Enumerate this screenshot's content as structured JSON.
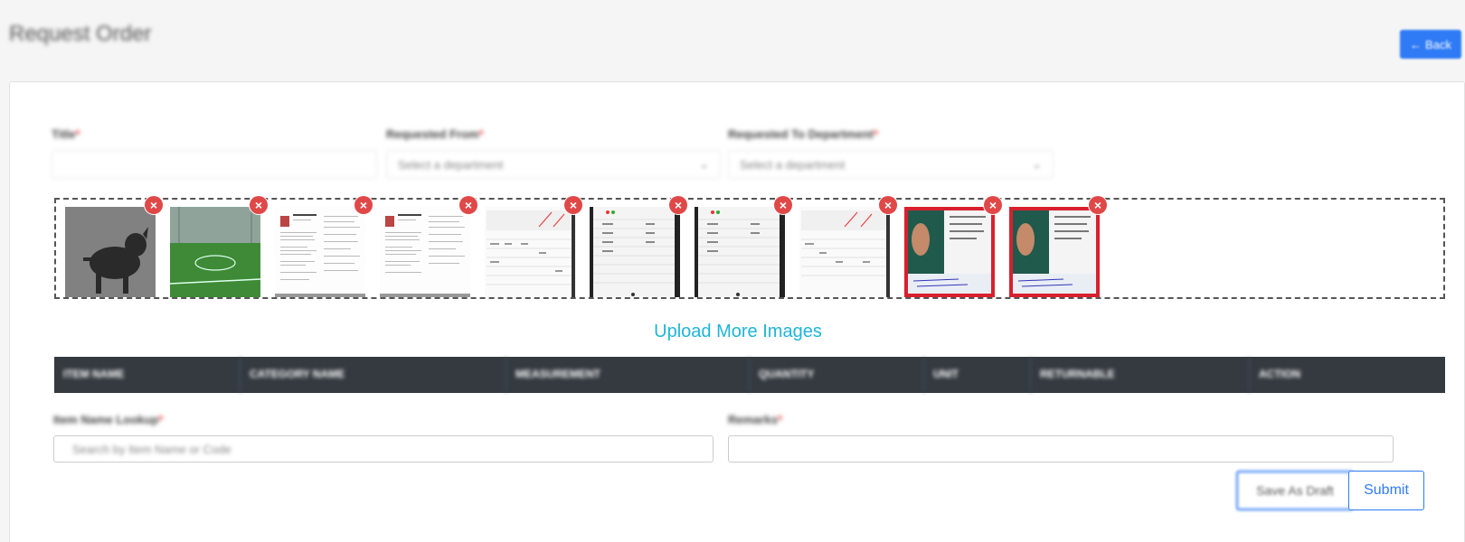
{
  "header": {
    "title": "Request Order",
    "back_label": "Back",
    "back_icon": "arrow-left-icon"
  },
  "form": {
    "title_label": "Title",
    "from_label": "Requested From",
    "from_placeholder": "Select a department",
    "to_label": "Requested To Department",
    "to_placeholder": "Select a department",
    "required_mark": "*"
  },
  "images": [
    {
      "name": "dog-photo",
      "kind": "dog"
    },
    {
      "name": "football-field-photo",
      "kind": "field"
    },
    {
      "name": "resume-document",
      "kind": "resume"
    },
    {
      "name": "resume-document-2",
      "kind": "resume"
    },
    {
      "name": "table-screenshot",
      "kind": "table-light"
    },
    {
      "name": "table-screenshot-dark",
      "kind": "table-dark"
    },
    {
      "name": "table-screenshot-dark-2",
      "kind": "table-dark"
    },
    {
      "name": "table-screenshot-2",
      "kind": "table-light"
    },
    {
      "name": "passport-photo",
      "kind": "passport"
    },
    {
      "name": "passport-photo-2",
      "kind": "passport"
    }
  ],
  "upload_more_label": "Upload More Images",
  "table": {
    "columns": [
      "ITEM NAME",
      "CATEGORY NAME",
      "MEASUREMENT",
      "QUANTITY",
      "UNIT",
      "RETURNABLE",
      "ACTION"
    ]
  },
  "lookup": {
    "label": "Item Name Lookup",
    "placeholder": "Search by Item Name or Code",
    "remarks_label": "Remarks"
  },
  "actions": {
    "draft_label": "Save As Draft",
    "submit_label": "Submit"
  },
  "colors": {
    "primary": "#2f7bf5",
    "link": "#1fb5d8",
    "table_header": "#343a40",
    "remove": "#e04848"
  }
}
